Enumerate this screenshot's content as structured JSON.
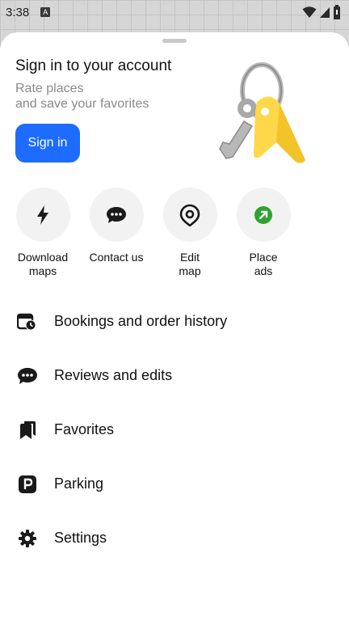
{
  "status_bar": {
    "time": "3:38",
    "notification_letter": "A"
  },
  "signin": {
    "title": "Sign in to your account",
    "subtitle_line1": "Rate places",
    "subtitle_line2": "and save your favorites",
    "button_label": "Sign in"
  },
  "actions": [
    {
      "label": "Download\nmaps",
      "icon": "lightning-icon"
    },
    {
      "label": "Contact us",
      "icon": "chat-bubble-icon"
    },
    {
      "label": "Edit\nmap",
      "icon": "map-pin-icon"
    },
    {
      "label": "Place\nads",
      "icon": "ads-arrow-icon"
    }
  ],
  "menu": [
    {
      "label": "Bookings and order history",
      "icon": "bookings-clock-icon"
    },
    {
      "label": "Reviews and edits",
      "icon": "chat-bubble-icon"
    },
    {
      "label": "Favorites",
      "icon": "bookmarks-icon"
    },
    {
      "label": "Parking",
      "icon": "parking-icon"
    },
    {
      "label": "Settings",
      "icon": "gear-icon"
    }
  ],
  "colors": {
    "primary": "#1d6cff",
    "ads_green": "#2fa32f",
    "key_yellow": "#ffd84a"
  }
}
